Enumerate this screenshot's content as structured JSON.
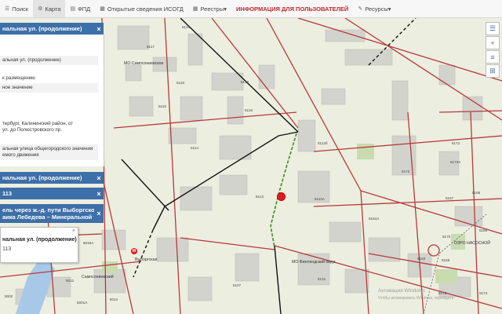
{
  "nav": [
    {
      "icon": "☰",
      "label": "Поиск"
    },
    {
      "icon": "⚙",
      "label": "Карта"
    },
    {
      "icon": "▤",
      "label": "ФПД"
    },
    {
      "icon": "▦",
      "label": "Открытые сведения ИСОГД"
    },
    {
      "icon": "▦",
      "label": "Реестры▾"
    },
    {
      "icon": "",
      "label": "ИНФОРМАЦИЯ ДЛЯ ПОЛЬЗОВАТЕЛЕЙ"
    },
    {
      "icon": "✎",
      "label": "Ресурсы▾"
    }
  ],
  "panel": {
    "header1": "нальная ул. (продолжение)",
    "rows": [
      "альная ул. (продолжение)",
      "к размещению",
      "ное значение",
      "тербург, Калининский район, от",
      "ул. до Полюстровского пр.",
      "альная улица общегородского значения",
      "емого движения"
    ],
    "header2": "нальная ул. (продолжение)",
    "header3": "113",
    "header4_line1": "ель через ж.-д. пути Выборгского",
    "header4_line2": "аика Лебедева – Минеральной ул.",
    "popup_title": "нальная ул. (продолжение)",
    "popup_sub": "113"
  },
  "map": {
    "districts": [
      "МО Сампсониевское",
      "МО Финляндский округ"
    ],
    "metro_label": "Выборгская",
    "block_labels": [
      "5117",
      "5121",
      "5122",
      "5118",
      "5115",
      "5114",
      "5116",
      "5113",
      "5113А",
      "5112б",
      "5131",
      "5164А",
      "5173",
      "5172",
      "5167",
      "5168",
      "5170",
      "5163",
      "5166",
      "5165",
      "5176",
      "5174",
      "5173",
      "5111",
      "5110",
      "5109",
      "5108",
      "5126",
      "5107",
      "5101",
      "5101А",
      "5104",
      "5103",
      "5102",
      "5105",
      "5015",
      "5011А",
      "5018А",
      "5012",
      "5016",
      "5014",
      "5001",
      "5002",
      "5003",
      "5006",
      "5007",
      "5001А",
      "5173А"
    ],
    "station_small": "Сампсониевский",
    "plant_label": "ОЗРО НАСОСНОЙ",
    "watermark_line1": "Активация Windows",
    "watermark_line2": "Чтобы активировать Windows, перейдите"
  },
  "side_buttons": [
    "☰",
    "+",
    "≡",
    "⊞",
    "−"
  ]
}
